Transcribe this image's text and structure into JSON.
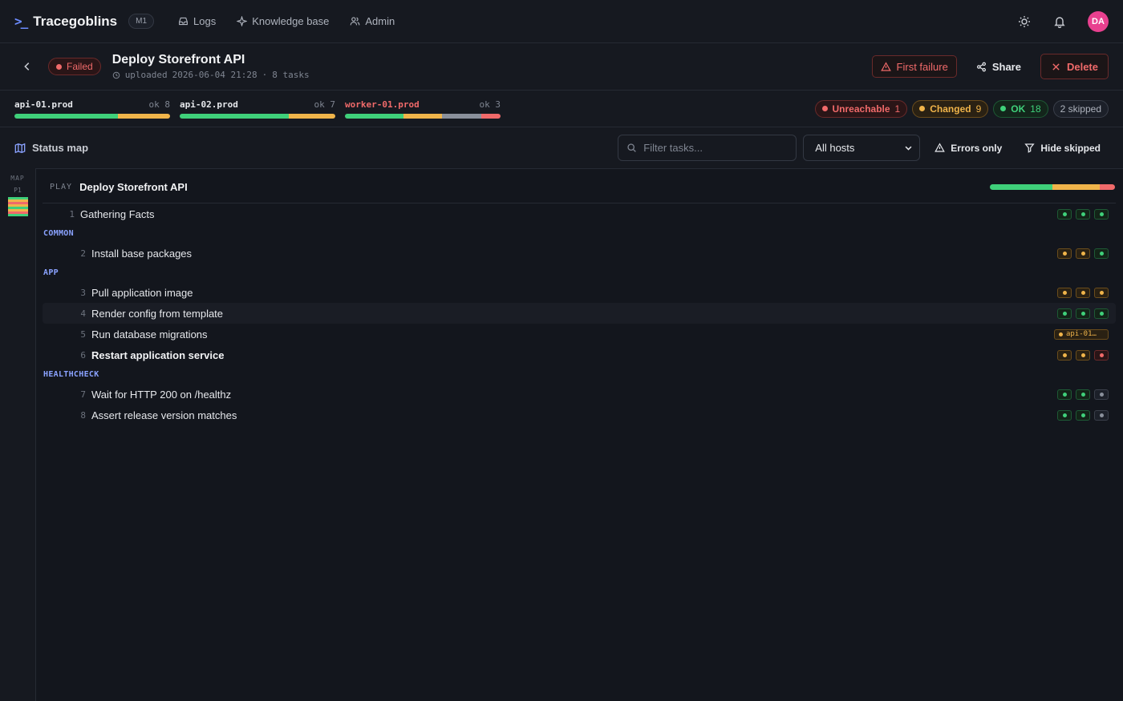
{
  "app": {
    "name": "Tracegoblins",
    "version_badge": "M1"
  },
  "nav": {
    "links": [
      {
        "label": "Logs",
        "icon": "inbox-icon"
      },
      {
        "label": "Knowledge base",
        "icon": "sparkle-icon"
      },
      {
        "label": "Admin",
        "icon": "users-icon"
      }
    ]
  },
  "user": {
    "initials": "DA"
  },
  "run": {
    "status": "Failed",
    "title": "Deploy Storefront API",
    "uploaded_label": "uploaded",
    "uploaded_at": "2026-06-04 21:28",
    "task_count": "8 tasks"
  },
  "actions": {
    "first_failure": "First failure",
    "share": "Share",
    "delete": "Delete"
  },
  "hosts": [
    {
      "name": "api-01.prod",
      "ok": "ok 8",
      "failed": false,
      "segments": [
        {
          "color": "#3fd07a",
          "value": 6
        },
        {
          "color": "#f0b44a",
          "value": 3
        }
      ]
    },
    {
      "name": "api-02.prod",
      "ok": "ok 7",
      "failed": false,
      "segments": [
        {
          "color": "#3fd07a",
          "value": 7
        },
        {
          "color": "#f0b44a",
          "value": 3
        }
      ]
    },
    {
      "name": "worker-01.prod",
      "ok": "ok 3",
      "failed": true,
      "segments": [
        {
          "color": "#3fd07a",
          "value": 3
        },
        {
          "color": "#f0b44a",
          "value": 2
        },
        {
          "color": "#8a909b",
          "value": 2
        },
        {
          "color": "#f06a6a",
          "value": 1
        }
      ]
    }
  ],
  "summary": {
    "unreachable_label": "Unreachable",
    "unreachable": "1",
    "changed_label": "Changed",
    "changed": "9",
    "ok_label": "OK",
    "ok": "18",
    "skipped": "2 skipped"
  },
  "toolbar": {
    "status_map": "Status map",
    "filter_placeholder": "Filter tasks...",
    "host_select": "All hosts",
    "errors_only": "Errors only",
    "hide_skipped": "Hide skipped"
  },
  "minimap": {
    "label": "MAP",
    "play": "P1"
  },
  "play": {
    "tag": "PLAY",
    "name": "Deploy Storefront API",
    "bar": [
      {
        "color": "#3fd07a",
        "value": 50
      },
      {
        "color": "#f0b44a",
        "value": 38
      },
      {
        "color": "#f06a6a",
        "value": 12
      }
    ]
  },
  "sections": [
    {
      "role": null,
      "tasks": [
        {
          "num": "1",
          "name": "Gathering Facts",
          "bold": false,
          "hl": false,
          "hosts": [
            "ok",
            "ok",
            "ok"
          ]
        }
      ]
    },
    {
      "role": "COMMON",
      "tasks": [
        {
          "num": "2",
          "name": "Install base packages",
          "bold": false,
          "hl": false,
          "hosts": [
            "changed",
            "changed",
            "ok"
          ]
        }
      ]
    },
    {
      "role": "APP",
      "tasks": [
        {
          "num": "3",
          "name": "Pull application image",
          "bold": false,
          "hl": false,
          "hosts": [
            "changed",
            "changed",
            "changed"
          ]
        },
        {
          "num": "4",
          "name": "Render config from template",
          "bold": false,
          "hl": true,
          "hosts": [
            "ok",
            "ok",
            "ok"
          ]
        },
        {
          "num": "5",
          "name": "Run database migrations",
          "bold": false,
          "hl": false,
          "wide": "api-01…"
        },
        {
          "num": "6",
          "name": "Restart application service",
          "bold": true,
          "hl": false,
          "hosts": [
            "changed",
            "changed",
            "failed"
          ]
        }
      ]
    },
    {
      "role": "HEALTHCHECK",
      "tasks": [
        {
          "num": "7",
          "name": "Wait for HTTP 200 on /healthz",
          "bold": false,
          "hl": false,
          "hosts": [
            "ok",
            "ok",
            "skipped"
          ]
        },
        {
          "num": "8",
          "name": "Assert release version matches",
          "bold": false,
          "hl": false,
          "hosts": [
            "ok",
            "ok",
            "skipped"
          ]
        }
      ]
    }
  ]
}
